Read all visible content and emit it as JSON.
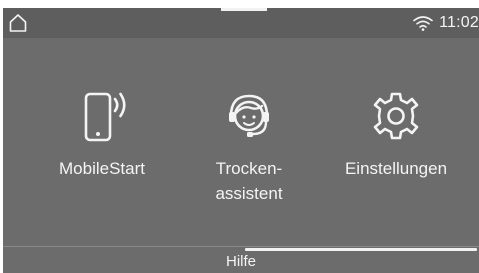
{
  "status_bar": {
    "home_icon": "home-icon",
    "wifi_icon": "wifi-icon",
    "time": "11:02"
  },
  "tiles": [
    {
      "icon": "smartphone-signal-icon",
      "label": "MobileStart"
    },
    {
      "icon": "headset-assistant-icon",
      "label": "Trocken-\nassistent"
    },
    {
      "icon": "gear-icon",
      "label": "Einstellungen"
    }
  ],
  "footer": {
    "help_label": "Hilfe"
  },
  "colors": {
    "screen_background": "#6c6c6c",
    "status_bar_background": "#5e5e5e",
    "foreground": "#f4f4f4"
  }
}
